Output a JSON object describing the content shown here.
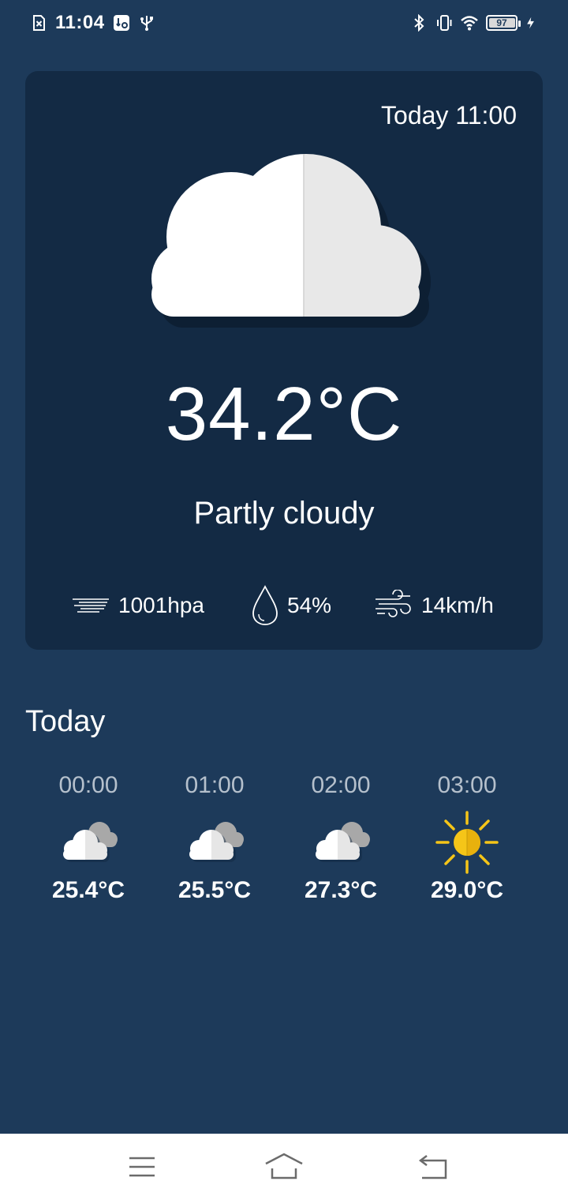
{
  "status_bar": {
    "time": "11:04",
    "battery": "97",
    "icons": [
      "sim-error-icon",
      "usb-settings-icon",
      "usb-icon",
      "bluetooth-icon",
      "vibrate-icon",
      "wifi-icon",
      "battery-icon",
      "charging-icon"
    ]
  },
  "current": {
    "date_label": "Today 11:00",
    "temperature": "34.2°C",
    "condition": "Partly cloudy",
    "condition_icon": "cloud-icon",
    "pressure": "1001hpa",
    "humidity": "54%",
    "wind": "14km/h"
  },
  "today": {
    "title": "Today",
    "hours": [
      {
        "time": "00:00",
        "icon": "cloud-icon",
        "temp": "25.4°C"
      },
      {
        "time": "01:00",
        "icon": "cloud-icon",
        "temp": "25.5°C"
      },
      {
        "time": "02:00",
        "icon": "cloud-icon",
        "temp": "27.3°C"
      },
      {
        "time": "03:00",
        "icon": "sun-icon",
        "temp": "29.0°C"
      }
    ]
  },
  "nav": {
    "items": [
      "menu-icon",
      "home-icon",
      "back-icon"
    ]
  },
  "colors": {
    "background": "#1d3a5a",
    "card": "#132a44",
    "sun": "#f5c518"
  }
}
